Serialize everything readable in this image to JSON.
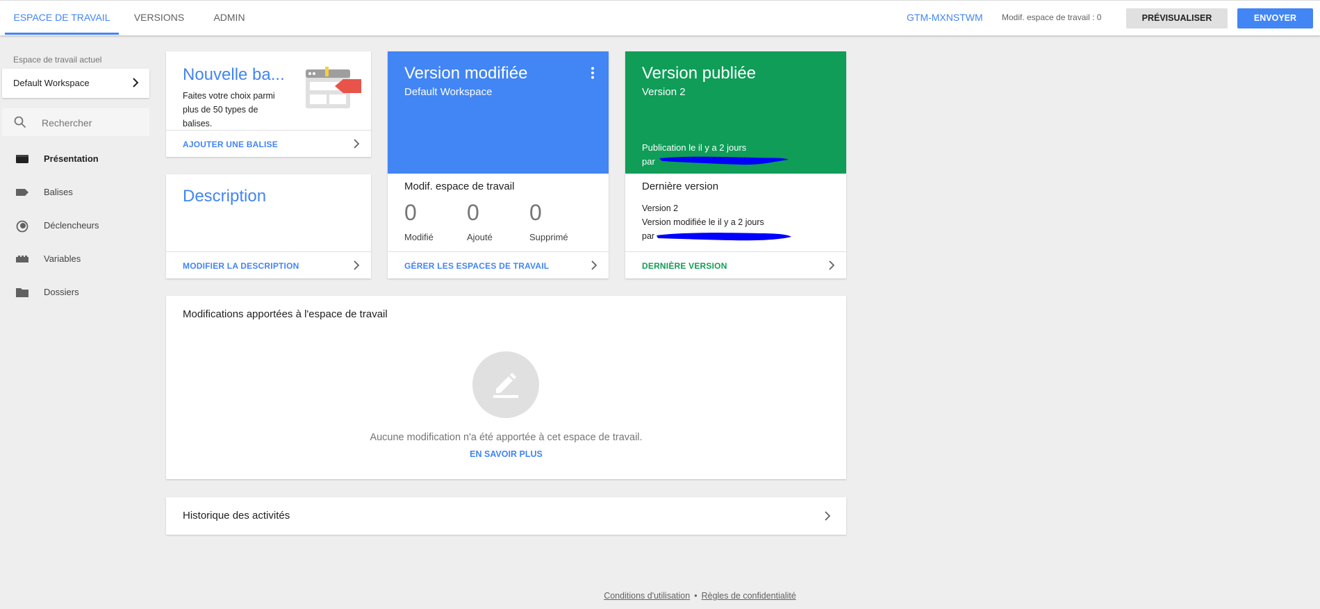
{
  "topbar": {
    "tabs": [
      {
        "label": "ESPACE DE TRAVAIL",
        "active": true
      },
      {
        "label": "VERSIONS",
        "active": false
      },
      {
        "label": "ADMIN",
        "active": false
      }
    ],
    "container_id": "GTM-MXNSTWM",
    "changes_count": "Modif. espace de travail : 0",
    "preview_label": "PRÉVISUALISER",
    "submit_label": "ENVOYER"
  },
  "sidebar": {
    "workspace_label": "Espace de travail actuel",
    "workspace_name": "Default Workspace",
    "search_placeholder": "Rechercher",
    "items": [
      {
        "label": "Présentation",
        "icon": "overview-icon",
        "active": true
      },
      {
        "label": "Balises",
        "icon": "tag-icon",
        "active": false
      },
      {
        "label": "Déclencheurs",
        "icon": "trigger-icon",
        "active": false
      },
      {
        "label": "Variables",
        "icon": "variables-icon",
        "active": false
      },
      {
        "label": "Dossiers",
        "icon": "folder-icon",
        "active": false
      }
    ]
  },
  "cards": {
    "new_tag": {
      "title": "Nouvelle ba...",
      "description": "Faites votre choix parmi plus de 50 types de balises.",
      "link": "AJOUTER UNE BALISE"
    },
    "description": {
      "title": "Description",
      "link": "MODIFIER LA DESCRIPTION"
    },
    "version_modified": {
      "title": "Version modifiée",
      "subtitle": "Default Workspace",
      "changes_label": "Modif. espace de travail",
      "stats": [
        {
          "value": "0",
          "label": "Modifié"
        },
        {
          "value": "0",
          "label": "Ajouté"
        },
        {
          "value": "0",
          "label": "Supprimé"
        }
      ],
      "link": "GÉRER LES ESPACES DE TRAVAIL"
    },
    "version_published": {
      "title": "Version publiée",
      "subtitle": "Version 2",
      "published_line": "Publication le il y a 2 jours",
      "published_by": "par",
      "latest_label": "Dernière version",
      "latest_version": "Version 2",
      "latest_modified": "Version modifiée le il y a 2 jours",
      "latest_by": "par",
      "link": "DERNIÈRE VERSION"
    },
    "workspace_changes": {
      "title": "Modifications apportées à l'espace de travail",
      "empty_text": "Aucune modification n'a été apportée à cet espace de travail.",
      "learn_more": "EN SAVOIR PLUS"
    },
    "history": {
      "title": "Historique des activités"
    }
  },
  "footer": {
    "terms": "Conditions d'utilisation",
    "separator": "•",
    "privacy": "Règles de confidentialité"
  },
  "colors": {
    "accent": "#4285f4",
    "published": "#0f9d58",
    "redaction": "#0000ff"
  }
}
